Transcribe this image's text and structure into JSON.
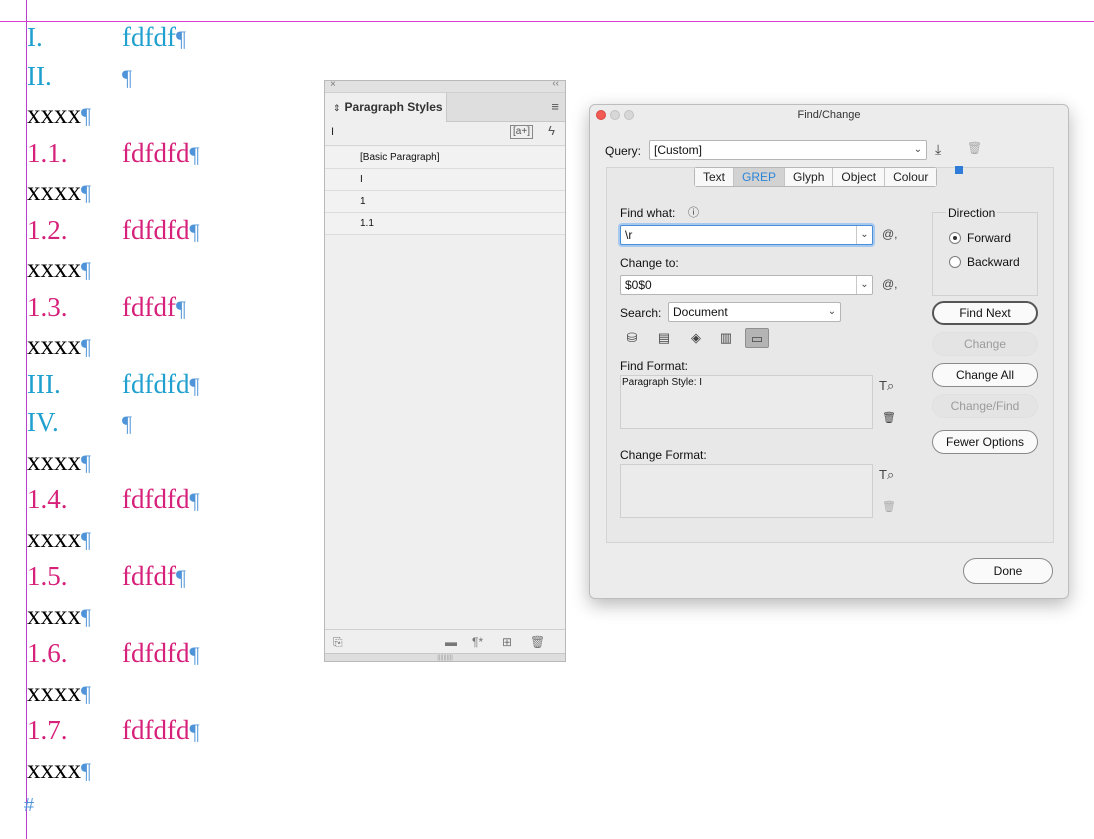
{
  "document": {
    "paragraphs": [
      {
        "style": "lvl1",
        "number": "I.",
        "text": "fdfdf",
        "mark": "¶"
      },
      {
        "style": "lvl1",
        "number": "II.",
        "text": "",
        "mark": "¶"
      },
      {
        "style": "body",
        "text": "xxxx",
        "mark": "¶"
      },
      {
        "style": "lvl2",
        "number": "1.1.",
        "text": "fdfdfd",
        "mark": "¶"
      },
      {
        "style": "body",
        "text": "xxxx",
        "mark": "¶"
      },
      {
        "style": "lvl2",
        "number": "1.2.",
        "text": "fdfdfd",
        "mark": "¶"
      },
      {
        "style": "body",
        "text": "xxxx",
        "mark": "¶"
      },
      {
        "style": "lvl2",
        "number": "1.3.",
        "text": "fdfdf",
        "mark": "¶"
      },
      {
        "style": "body",
        "text": "xxxx",
        "mark": "¶"
      },
      {
        "style": "lvl1",
        "number": "III.",
        "text": "fdfdfd",
        "mark": "¶"
      },
      {
        "style": "lvl1",
        "number": "IV.",
        "text": "",
        "mark": "¶"
      },
      {
        "style": "body",
        "text": "xxxx",
        "mark": "¶"
      },
      {
        "style": "lvl2",
        "number": "1.4.",
        "text": "fdfdfd",
        "mark": "¶"
      },
      {
        "style": "body",
        "text": "xxxx",
        "mark": "¶"
      },
      {
        "style": "lvl2",
        "number": "1.5.",
        "text": "fdfdf",
        "mark": "¶"
      },
      {
        "style": "body",
        "text": "xxxx",
        "mark": "¶"
      },
      {
        "style": "lvl2",
        "number": "1.6.",
        "text": "fdfdfd",
        "mark": "¶"
      },
      {
        "style": "body",
        "text": "xxxx",
        "mark": "¶"
      },
      {
        "style": "lvl2",
        "number": "1.7.",
        "text": "fdfdfd",
        "mark": "¶"
      },
      {
        "style": "body",
        "text": "xxxx",
        "mark": "¶"
      }
    ],
    "end_of_story": "#",
    "colors": {
      "level1": "#20a0cf",
      "level2": "#d6207a",
      "hidden_chars": "#4f94d8",
      "guides": "#d93bd6"
    }
  },
  "paragraph_styles_panel": {
    "close_glyph": "×",
    "collapse_glyph": "‹‹",
    "tab_arrows": "⌃⌄",
    "title": "Paragraph Styles",
    "menu_glyph": "≡",
    "current_style": "I",
    "new_from_selection_glyph": "[a+]",
    "quick_apply_glyph": "ϟ",
    "styles": [
      "[Basic Paragraph]",
      "I",
      "1",
      "1.1"
    ],
    "bottom_icons": [
      "load-styles-icon",
      "folder-icon",
      "clear-overrides-icon",
      "new-style-icon",
      "trash-icon"
    ]
  },
  "find_change": {
    "title": "Find/Change",
    "query_label": "Query:",
    "query_value": "[Custom]",
    "tabs": [
      "Text",
      "GREP",
      "Glyph",
      "Object",
      "Colour"
    ],
    "active_tab": "GREP",
    "find_what_label": "Find what:",
    "find_what_value": "\\r",
    "change_to_label": "Change to:",
    "change_to_value": "$0$0",
    "search_label": "Search:",
    "search_value": "Document",
    "find_format_label": "Find Format:",
    "find_format_value": "Paragraph Style: I",
    "change_format_label": "Change Format:",
    "change_format_value": "",
    "direction_label": "Direction",
    "direction_options": [
      "Forward",
      "Backward"
    ],
    "direction_selected": "Forward",
    "buttons": {
      "find_next": "Find Next",
      "change": "Change",
      "change_all": "Change All",
      "change_find": "Change/Find",
      "fewer_options": "Fewer Options",
      "done": "Done"
    },
    "special_char_glyph": "@,",
    "accent_color": "#2a84d9"
  }
}
